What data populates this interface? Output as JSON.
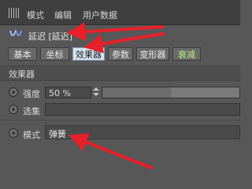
{
  "menu": {
    "items": [
      "模式",
      "编辑",
      "用户数据"
    ]
  },
  "object": {
    "title": "延迟 [延迟]",
    "icon": "cloner-effector-icon"
  },
  "tabs": [
    {
      "label": "基本",
      "active": false
    },
    {
      "label": "坐标",
      "active": false
    },
    {
      "label": "效果器",
      "active": true
    },
    {
      "label": "参数",
      "active": false
    },
    {
      "label": "变形器",
      "active": false
    },
    {
      "label": "衰减",
      "active": false,
      "accent": true
    }
  ],
  "section": {
    "title": "效果器"
  },
  "params": {
    "strength": {
      "label": "强度",
      "value": "50 %",
      "slider_fraction": 0.5
    },
    "selection": {
      "label": "选集",
      "value": ""
    },
    "mode": {
      "label": "模式",
      "value": "弹簧"
    }
  },
  "colors": {
    "annotation": "#e8202a",
    "active_tab": "#d7e3f1",
    "accent_tab_text": "#b4f57f"
  }
}
